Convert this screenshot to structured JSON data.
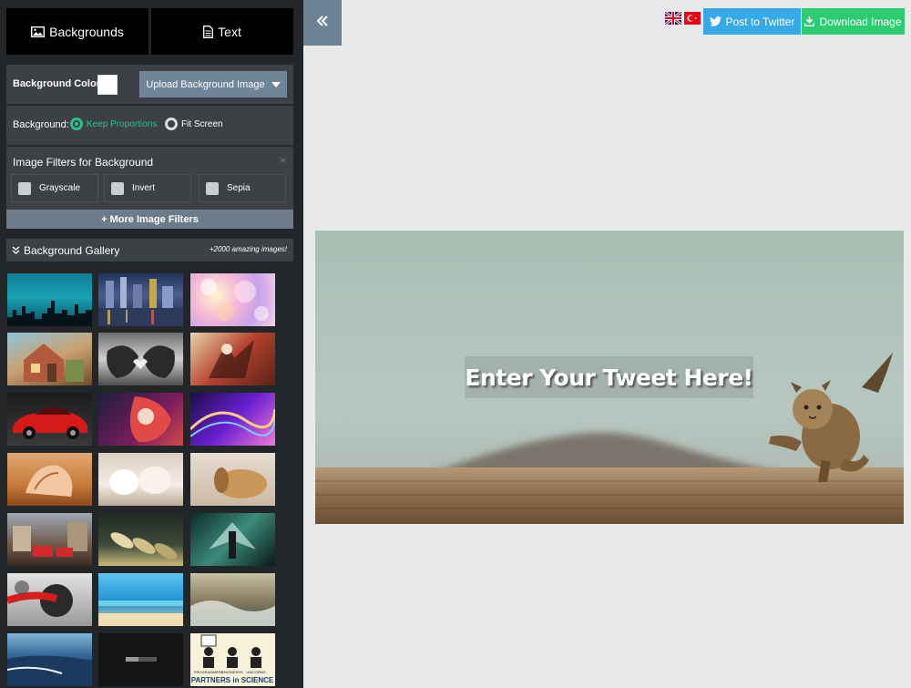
{
  "tabs": {
    "backgrounds_label": "Backgrounds",
    "text_label": "Text"
  },
  "background_color": {
    "label": "Background Color:",
    "value": "#ffffff"
  },
  "upload": {
    "label": "Upload Background Image"
  },
  "background_mode": {
    "label": "Background:",
    "options": [
      "Keep Proportions",
      "Fit Screen"
    ],
    "selected": "Keep Proportions"
  },
  "filters": {
    "title": "Image Filters for Background",
    "close_glyph": "×",
    "options": [
      "Grayscale",
      "Invert",
      "Sepia"
    ],
    "more_label": "+ More Image Filters"
  },
  "gallery": {
    "title": "Background Gallery",
    "count_text": "+2000 amazing images!",
    "thumbnails": [
      {
        "name": "city-skyline-teal"
      },
      {
        "name": "city-night-lights"
      },
      {
        "name": "bokeh-pastel"
      },
      {
        "name": "fantasy-house"
      },
      {
        "name": "sneakers-heart"
      },
      {
        "name": "anime-fighters"
      },
      {
        "name": "red-sports-car"
      },
      {
        "name": "anime-girl-red-hair"
      },
      {
        "name": "purple-light-waves"
      },
      {
        "name": "seashell-beach"
      },
      {
        "name": "white-kittens"
      },
      {
        "name": "sleeping-dog"
      },
      {
        "name": "city-street-buses"
      },
      {
        "name": "shoes-row"
      },
      {
        "name": "angel-warrior"
      },
      {
        "name": "red-paint-face"
      },
      {
        "name": "tropical-sea"
      },
      {
        "name": "ocean-waves"
      },
      {
        "name": "coast-sunset"
      },
      {
        "name": "dark-loading"
      },
      {
        "name": "partners-in-science",
        "caption": "PARTNERS in SCIENCE",
        "labels": [
          "PROGRAMMERS",
          "ENGINEERS",
          "UNICORNS"
        ]
      }
    ]
  },
  "header": {
    "twitter_label": "Post to Twitter",
    "download_label": "Download Image",
    "languages": [
      "English",
      "Turkish"
    ]
  },
  "canvas": {
    "tweet_text": "Enter Your Tweet Here!"
  },
  "colors": {
    "sidebar": "#232629",
    "panel": "#3d4145",
    "accent_green": "#2fbf8a",
    "twitter": "#37a9e6",
    "download": "#2ecc71",
    "collapse": "#6d8394"
  }
}
